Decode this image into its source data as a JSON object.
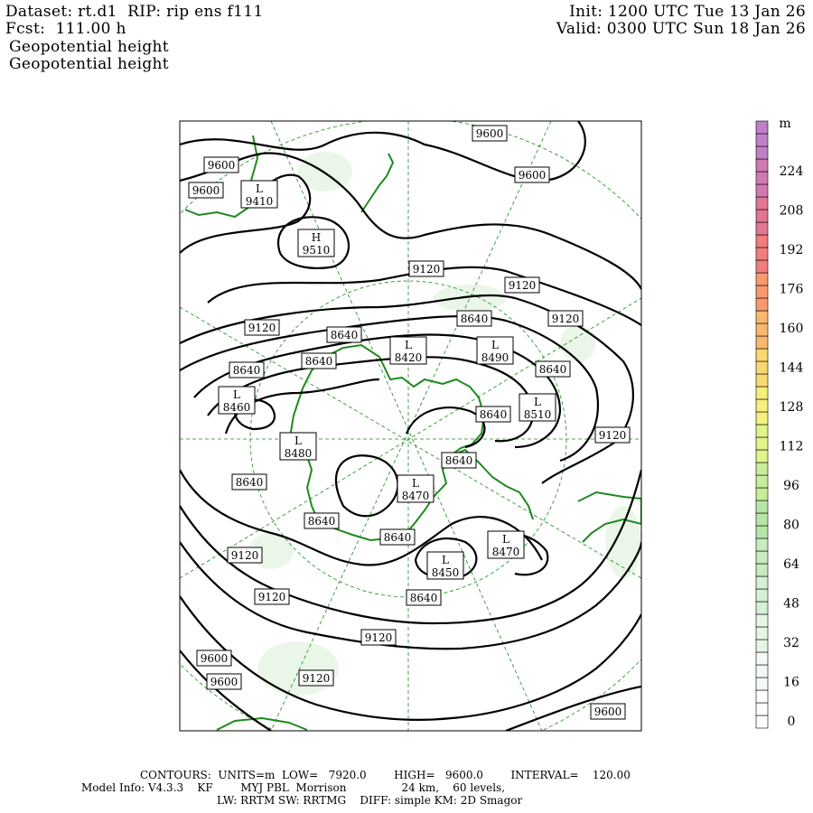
{
  "header": {
    "dataset": "Dataset: rt.d1  RIP: rip ens f111",
    "fcst": "Fcst:  111.00 h",
    "field1": "Geopotential height",
    "field2": "Geopotential height",
    "init": "Init: 1200 UTC Tue 13 Jan 26",
    "valid": "Valid: 0300 UTC Sun 18 Jan 26"
  },
  "footer": {
    "line1": "CONTOURS:  UNITS=m  LOW=   7920.0        HIGH=   9600.0        INTERVAL=    120.00",
    "line2": "Model Info: V4.3.3    KF        MYJ PBL  Morrison                24 km,    60 levels,",
    "line3": "LW: RRTM SW: RRTMG    DIFF: simple KM: 2D Smagor"
  },
  "colorbar": {
    "unit": "m",
    "labels": [
      "0",
      "16",
      "32",
      "48",
      "64",
      "80",
      "96",
      "112",
      "128",
      "144",
      "160",
      "176",
      "192",
      "208",
      "224"
    ],
    "colors": [
      "#ffffff",
      "#f4fbf4",
      "#e6f6e6",
      "#d6f1d4",
      "#c6ecc0",
      "#b6e6a8",
      "#c8ee9a",
      "#e0f48c",
      "#f4f07e",
      "#f8d870",
      "#f8b870",
      "#f89a70",
      "#f07e7e",
      "#e07892",
      "#d07ab0",
      "#c080c8"
    ]
  },
  "map": {
    "contours": {
      "low": 7920,
      "high": 9600,
      "interval": 120,
      "units": "m"
    },
    "labels": [
      {
        "text": "9600"
      },
      {
        "text": "9600"
      },
      {
        "text": "9600"
      },
      {
        "text": "9600"
      },
      {
        "text": "9600"
      },
      {
        "text": "9600"
      },
      {
        "text": "9600"
      },
      {
        "text": "9600"
      },
      {
        "text": "9120"
      },
      {
        "text": "9120"
      },
      {
        "text": "9120"
      },
      {
        "text": "9120"
      },
      {
        "text": "9120"
      },
      {
        "text": "9120"
      },
      {
        "text": "9120"
      },
      {
        "text": "9120"
      },
      {
        "text": "9120"
      },
      {
        "text": "8640"
      },
      {
        "text": "8640"
      },
      {
        "text": "8640"
      },
      {
        "text": "8640"
      },
      {
        "text": "8640"
      },
      {
        "text": "8640"
      },
      {
        "text": "8640"
      },
      {
        "text": "8640"
      },
      {
        "text": "8640"
      },
      {
        "text": "8640"
      },
      {
        "text": "8640"
      },
      {
        "text": "8640"
      }
    ],
    "centers": [
      {
        "type": "L",
        "value": "9410"
      },
      {
        "type": "H",
        "value": "9510"
      },
      {
        "type": "L",
        "value": "8420"
      },
      {
        "type": "L",
        "value": "8490"
      },
      {
        "type": "L",
        "value": "8460"
      },
      {
        "type": "L",
        "value": "8510"
      },
      {
        "type": "L",
        "value": "8480"
      },
      {
        "type": "L",
        "value": "8470"
      },
      {
        "type": "L",
        "value": "8470"
      },
      {
        "type": "L",
        "value": "8450"
      }
    ]
  }
}
